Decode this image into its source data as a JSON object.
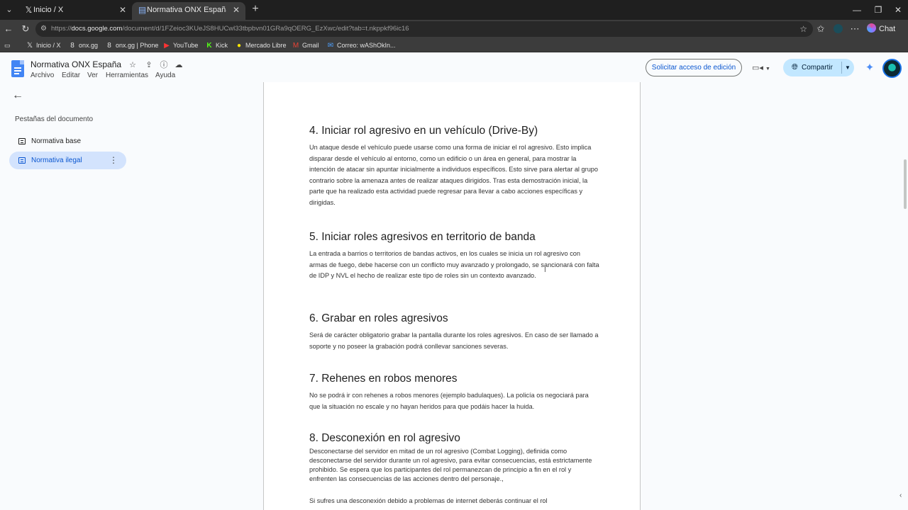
{
  "browser": {
    "tabs": [
      {
        "title": "Inicio / X",
        "icon": "x-logo-icon"
      },
      {
        "title": "Normativa ONX España - Docume",
        "icon": "google-docs-icon"
      }
    ],
    "url_prefix": "https://",
    "url_host": "docs.google.com",
    "url_path": "/document/d/1FZeioc3KUeJS8HUCwl33tbpbvn01GRa9qOERG_EzXwc/edit?tab=t.nkppkf96ic16",
    "chat_label": "Chat",
    "bookmarks": [
      {
        "label": "Inicio / X",
        "icon": "x-logo-icon"
      },
      {
        "label": "onx.gg",
        "icon": "onx-logo-icon"
      },
      {
        "label": "onx.gg | Phone",
        "icon": "onx-logo-icon"
      },
      {
        "label": "YouTube",
        "icon": "youtube-icon"
      },
      {
        "label": "Kick",
        "icon": "kick-icon"
      },
      {
        "label": "Mercado Libre",
        "icon": "mercado-libre-icon"
      },
      {
        "label": "Gmail",
        "icon": "gmail-icon"
      },
      {
        "label": "Correo: wAShOkIn...",
        "icon": "outlook-icon"
      }
    ]
  },
  "docs": {
    "title": "Normativa ONX España",
    "menu": [
      "Archivo",
      "Editar",
      "Ver",
      "Herramientas",
      "Ayuda"
    ],
    "request_access": "Solicitar acceso de edición",
    "share": "Compartir",
    "colors": {
      "accent": "#0b57d0",
      "share_bg": "#c2e7ff",
      "active_tab_bg": "#d3e3fd"
    }
  },
  "sidebar": {
    "heading": "Pestañas del documento",
    "tabs": [
      {
        "label": "Normativa base",
        "active": false
      },
      {
        "label": "Normativa ilegal",
        "active": true
      }
    ]
  },
  "document": {
    "sections": [
      {
        "heading": "4. Iniciar rol agresivo en un vehículo (Drive-By)",
        "body": "Un ataque desde el vehículo puede usarse como una forma de iniciar el rol agresivo. Esto implica disparar desde el vehículo al entorno, como un edificio o un área en general, para mostrar la intención de atacar sin apuntar inicialmente a individuos específicos. Esto sirve para alertar al grupo contrario sobre la amenaza antes de realizar ataques dirigidos. Tras esta demostración inicial, la parte que ha realizado esta actividad puede regresar para llevar a cabo acciones específicas y dirigidas."
      },
      {
        "heading": "5. Iniciar roles agresivos en territorio de banda",
        "body": "La entrada a barrios o territorios de bandas activos, en los cuales se inicia un rol agresivo con armas de fuego, debe hacerse con un conflicto muy avanzado y prolongado, se sancionará con falta de IDP y NVL el hecho de realizar este tipo de roles sin un contexto avanzado."
      },
      {
        "heading": "6. Grabar en roles agresivos",
        "body": "Será de carácter obligatorio grabar la pantalla durante los roles agresivos. En caso de ser llamado a soporte y no poseer la grabación podrá conllevar sanciones severas."
      },
      {
        "heading": "7. Rehenes en robos menores",
        "body": "No se podrá ir con rehenes a robos menores (ejemplo badulaques). La policía os negociará para que la situación no escale y no hayan heridos para que podáis hacer la huida."
      },
      {
        "heading": "8. Desconexión en rol agresivo",
        "body": "Desconectarse del servidor en mitad de un rol agresivo (Combat Logging), definida como desconectarse del servidor durante un rol agresivo, para evitar consecuencias, está estrictamente prohibido. Se espera que los participantes del rol permanezcan de principio a fin en el rol y enfrenten las consecuencias de las acciones dentro del personaje.,",
        "body2": "Si sufres una desconexión debido a problemas de internet deberás continuar el rol"
      }
    ]
  }
}
